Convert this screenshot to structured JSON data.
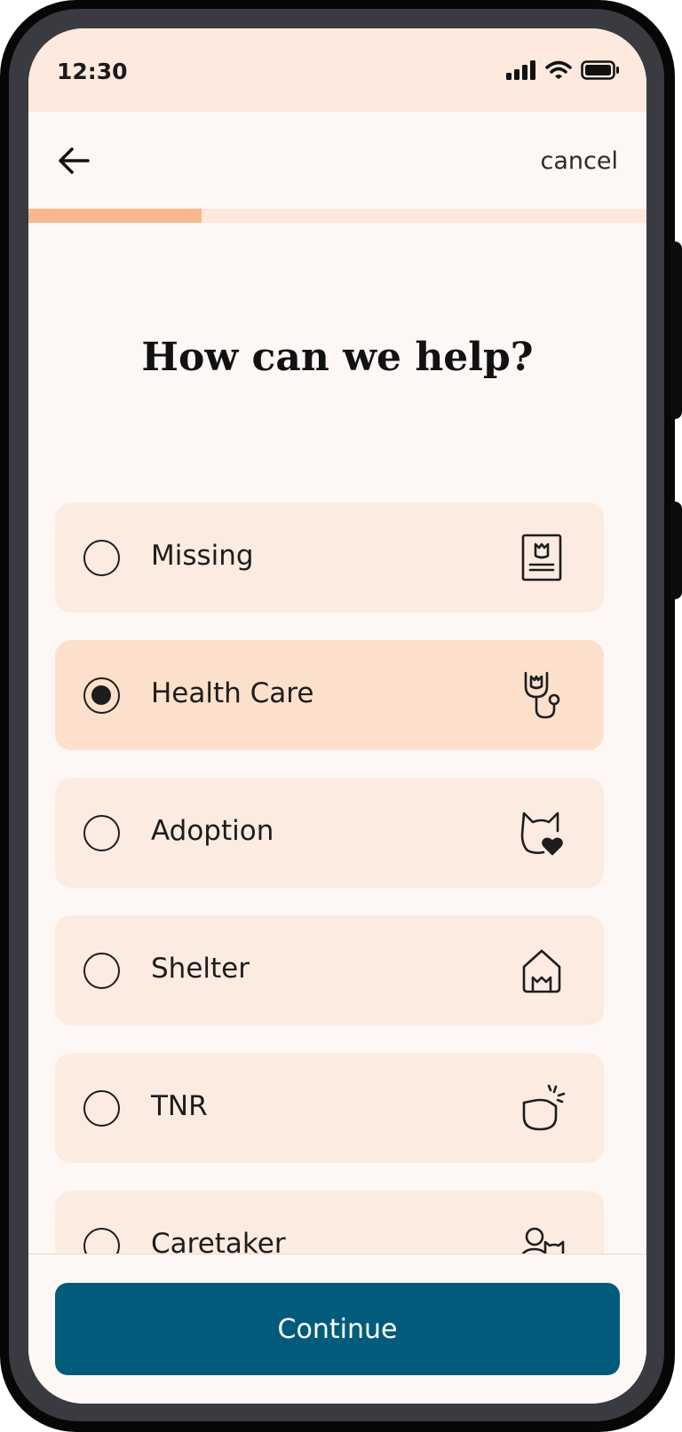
{
  "status_bar": {
    "time": "12:30",
    "icons": [
      "signal-icon",
      "wifi-icon",
      "battery-icon"
    ]
  },
  "header": {
    "back_icon": "arrow-left-icon",
    "cancel_label": "cancel"
  },
  "progress": {
    "value": 0.28,
    "fill_color": "#f9b88f",
    "track_color": "#fde8dc"
  },
  "main": {
    "title": "How can we help?"
  },
  "options": [
    {
      "label": "Missing",
      "icon": "missing-poster-icon",
      "selected": false
    },
    {
      "label": "Health Care",
      "icon": "stethoscope-icon",
      "selected": true
    },
    {
      "label": "Adoption",
      "icon": "cat-heart-icon",
      "selected": false
    },
    {
      "label": "Shelter",
      "icon": "cat-house-icon",
      "selected": false
    },
    {
      "label": "TNR",
      "icon": "ear-tip-cat-icon",
      "selected": false
    },
    {
      "label": "Caretaker",
      "icon": "person-cat-icon",
      "selected": false
    }
  ],
  "footer": {
    "continue_label": "Continue",
    "button_color": "#025b7b"
  }
}
